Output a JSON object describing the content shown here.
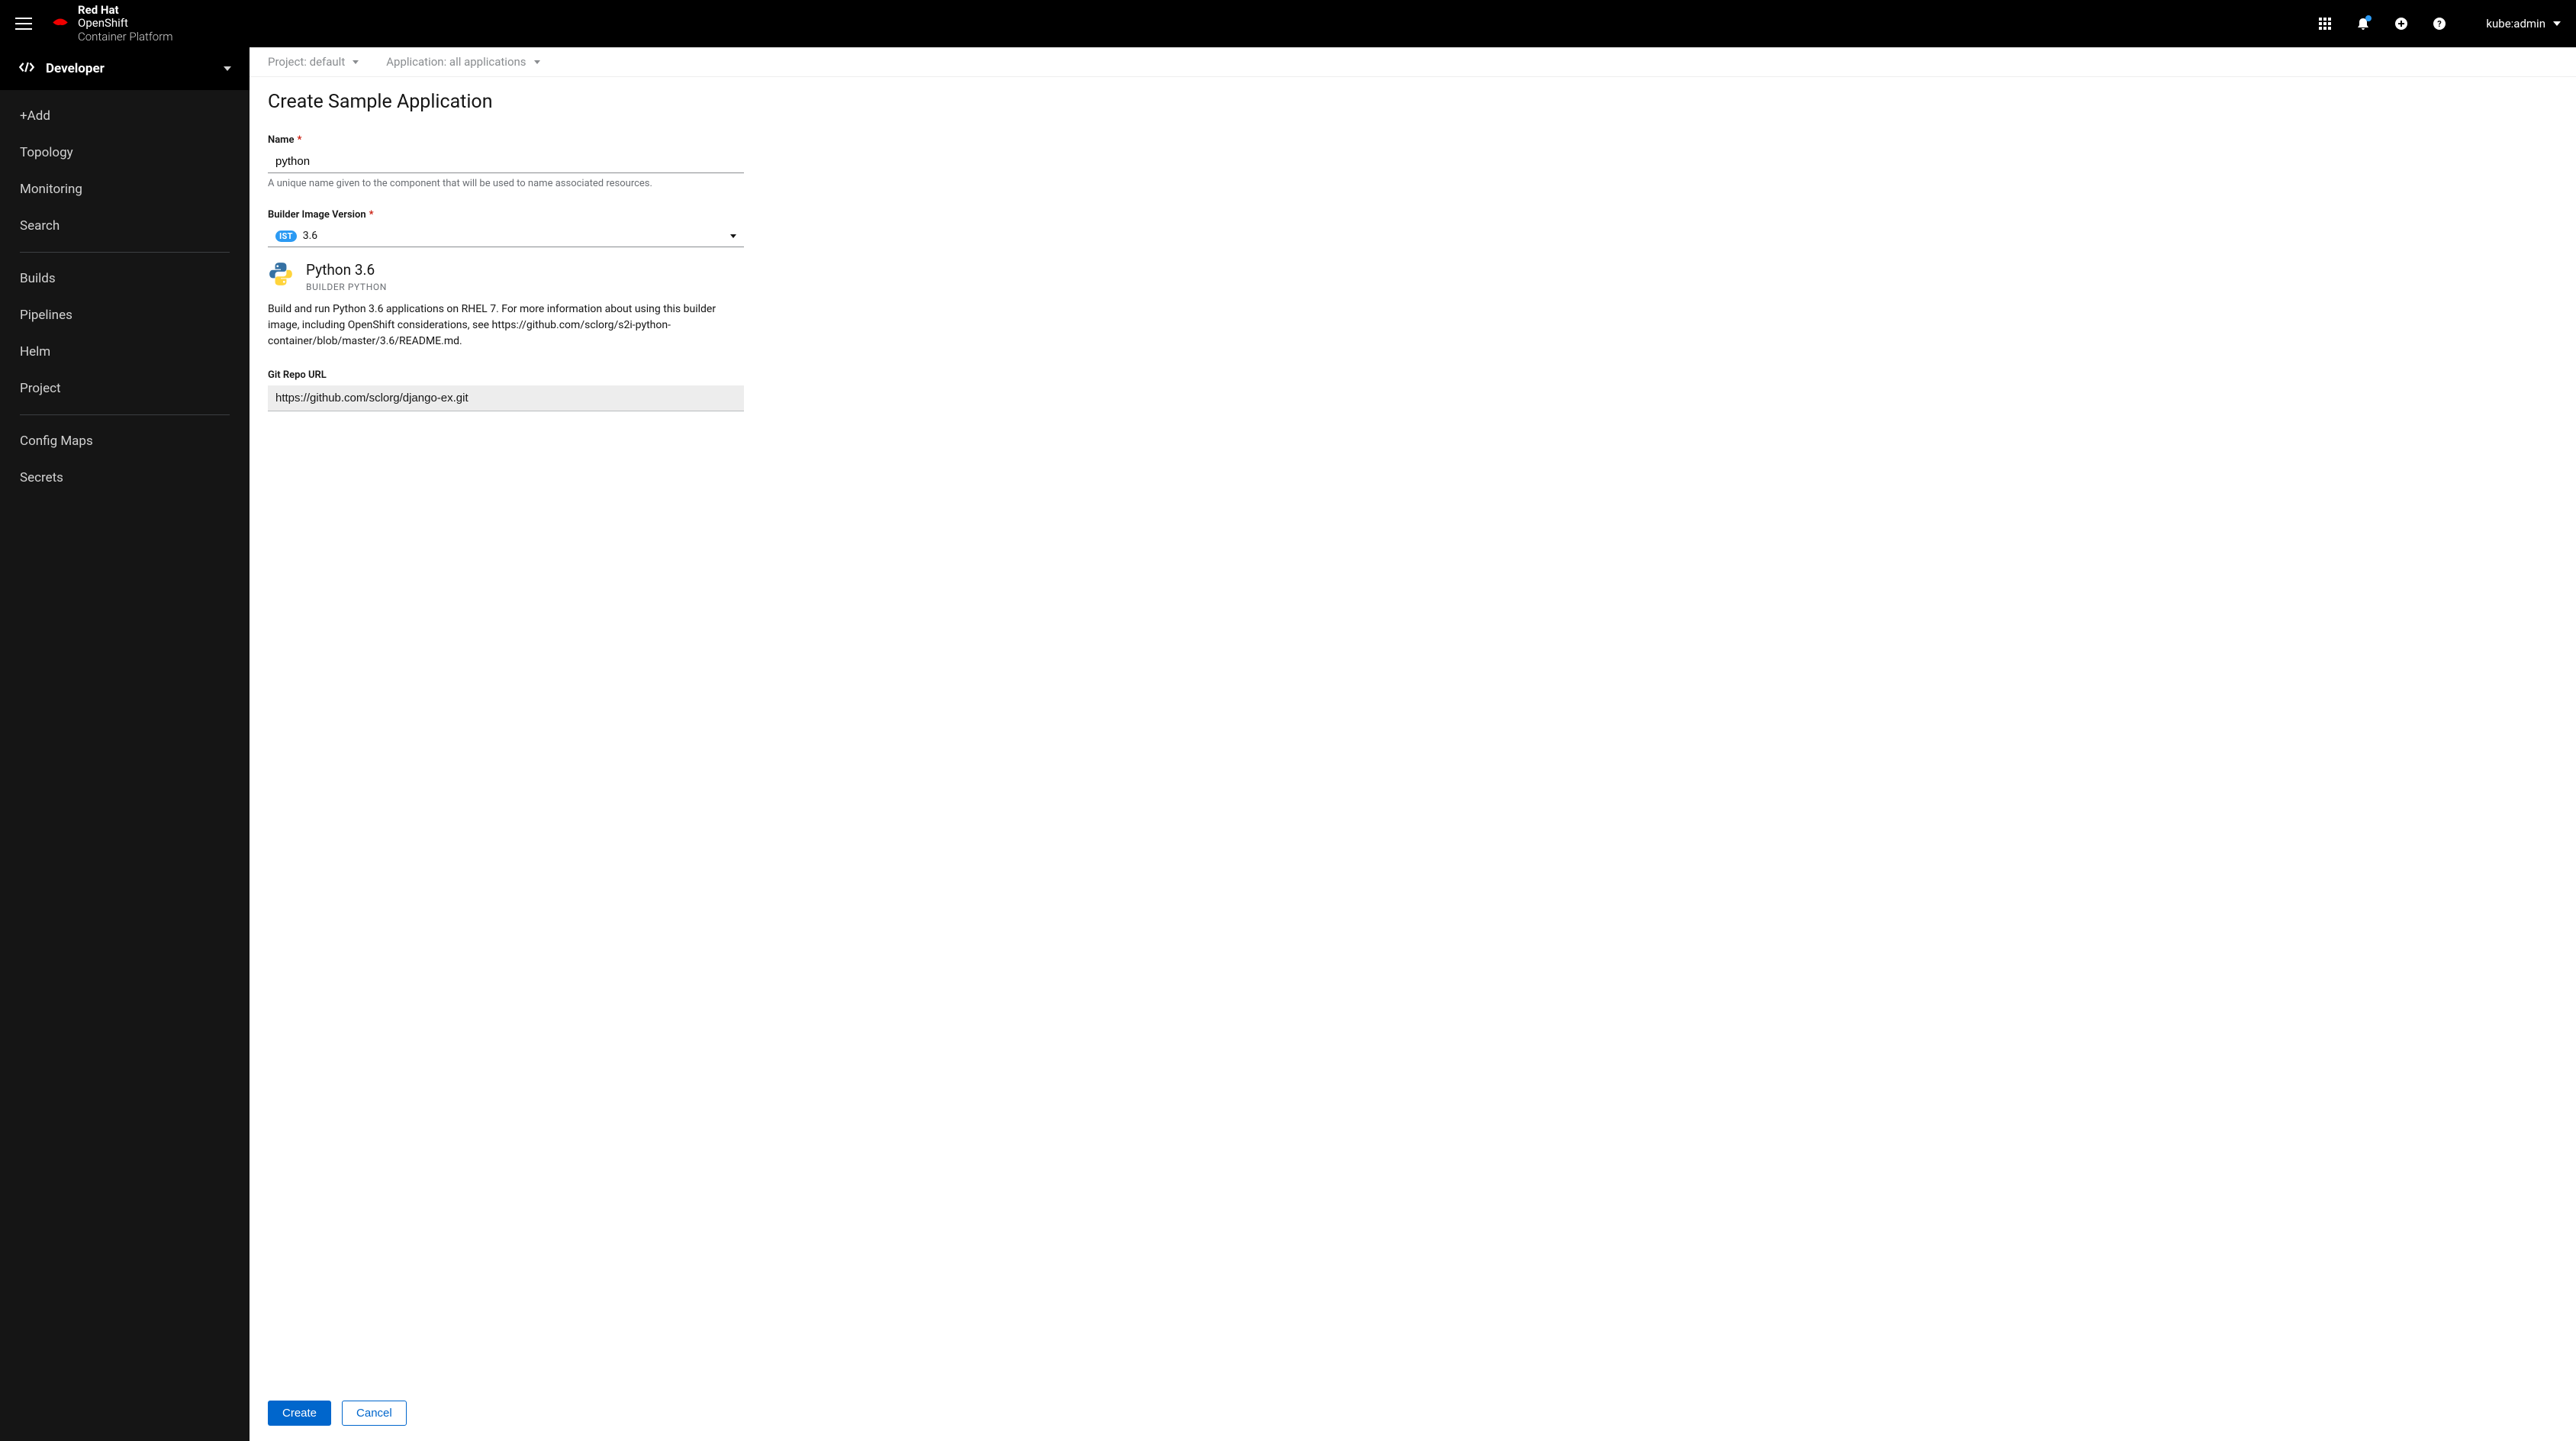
{
  "brand": {
    "line1": "Red Hat",
    "line2": "OpenShift",
    "line3": "Container Platform"
  },
  "user": {
    "name": "kube:admin"
  },
  "perspective": {
    "label": "Developer"
  },
  "sidebar": {
    "items": [
      {
        "label": "+Add"
      },
      {
        "label": "Topology"
      },
      {
        "label": "Monitoring"
      },
      {
        "label": "Search"
      },
      {
        "divider": true
      },
      {
        "label": "Builds"
      },
      {
        "label": "Pipelines"
      },
      {
        "label": "Helm"
      },
      {
        "label": "Project"
      },
      {
        "divider": true
      },
      {
        "label": "Config Maps"
      },
      {
        "label": "Secrets"
      }
    ]
  },
  "context": {
    "project_label": "Project: default",
    "application_label": "Application: all applications"
  },
  "page": {
    "title": "Create Sample Application"
  },
  "form": {
    "name_label": "Name",
    "name_value": "python",
    "name_help": "A unique name given to the component that will be used to name associated resources.",
    "builder_label": "Builder Image Version",
    "builder_badge": "IST",
    "builder_value": "3.6",
    "builder_title": "Python 3.6",
    "builder_tags": "BUILDER  PYTHON",
    "builder_desc": "Build and run Python 3.6 applications on RHEL 7. For more information about using this builder image, including OpenShift considerations, see https://github.com/sclorg/s2i-python-container/blob/master/3.6/README.md.",
    "git_label": "Git Repo URL",
    "git_value": "https://github.com/sclorg/django-ex.git"
  },
  "footer": {
    "create": "Create",
    "cancel": "Cancel"
  }
}
